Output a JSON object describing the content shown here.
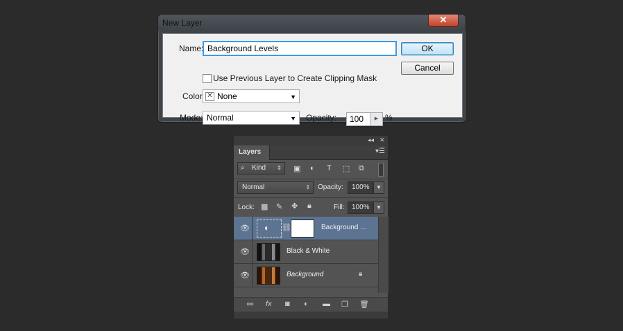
{
  "dialog": {
    "title": "New Layer",
    "close_glyph": "✕",
    "name_label": "Name:",
    "name_value": "Background Levels",
    "clipping_mask_label": "Use Previous Layer to Create Clipping Mask",
    "clipping_mask_checked": false,
    "color_label": "Color:",
    "color_value": "None",
    "mode_label": "Mode:",
    "mode_value": "Normal",
    "opacity_label": "Opacity:",
    "opacity_value": "100",
    "opacity_unit": "%",
    "ok_label": "OK",
    "cancel_label": "Cancel"
  },
  "layers_panel": {
    "tab_label": "Layers",
    "filter_kind": "Kind",
    "blend_mode": "Normal",
    "opacity_label": "Opacity:",
    "opacity_value": "100%",
    "lock_label": "Lock:",
    "fill_label": "Fill:",
    "fill_value": "100%",
    "layers": [
      {
        "name": "Background ...",
        "selected": true,
        "type": "adjustment",
        "has_mask": true
      },
      {
        "name": "Black & White",
        "selected": false,
        "type": "image"
      },
      {
        "name": "Background",
        "selected": false,
        "type": "image",
        "locked": true,
        "italic": true
      }
    ],
    "bottom_icons": [
      "link-icon",
      "fx-icon",
      "add-mask-icon",
      "adjustment-icon",
      "folder-icon",
      "new-layer-icon",
      "trash-icon"
    ]
  },
  "colors": {
    "app_background": "#2b2b2b",
    "selected_layer": "#5c7391",
    "focus_border": "#3c9be6",
    "close_button": "#c2412b"
  }
}
